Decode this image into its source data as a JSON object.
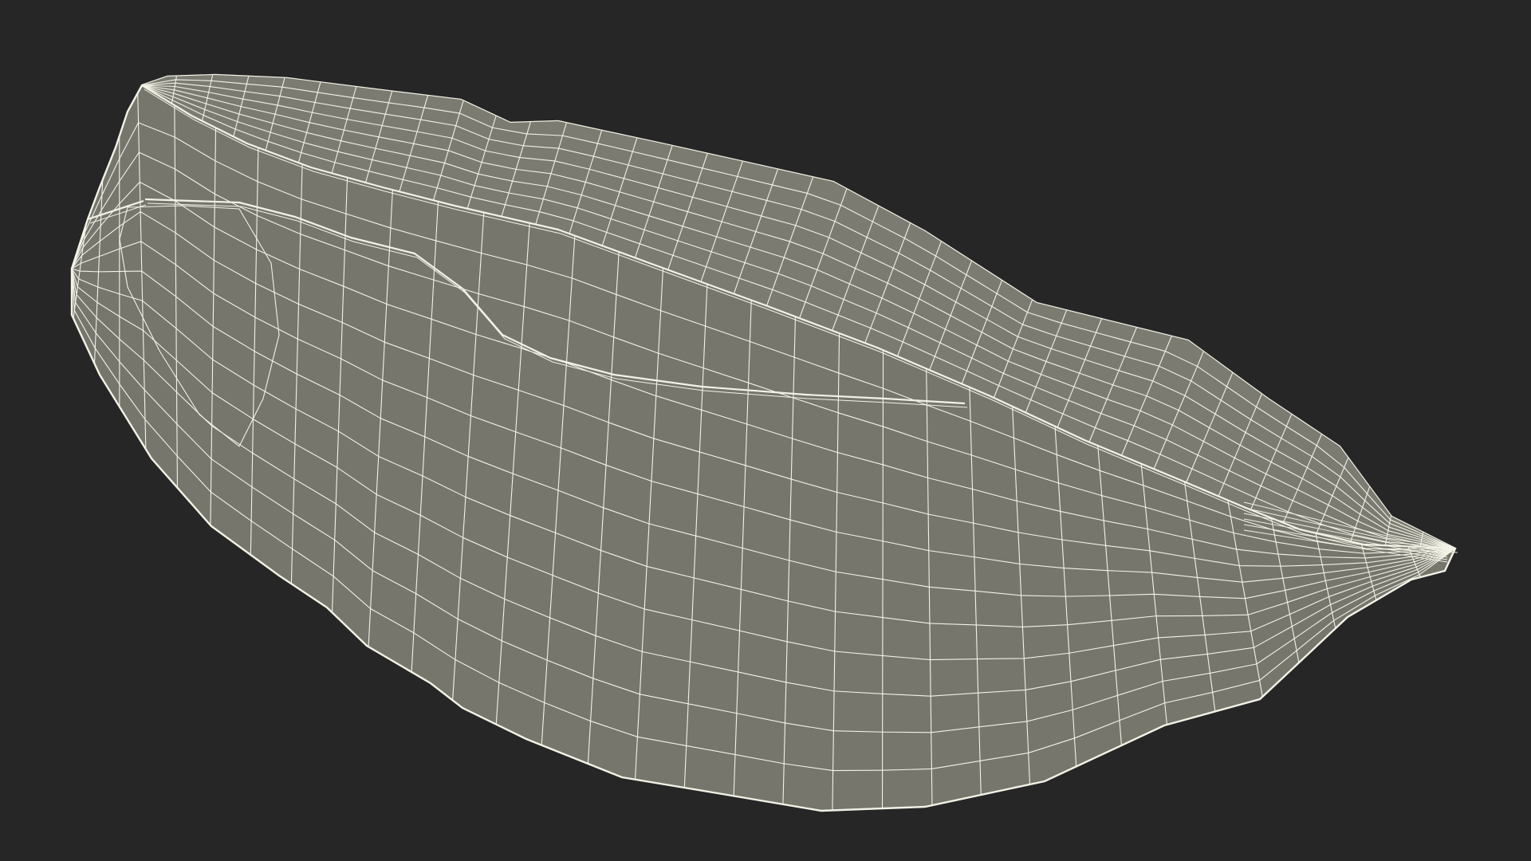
{
  "scene": {
    "background_color": "#262626",
    "mesh_fill_color": "#76766d",
    "top_fill_color": "#7b7b72",
    "wire_color": "#f2f2e6",
    "display_mode": "wireframe-on-shaded",
    "object": "wireframe-leaf-shaped-3d-mesh"
  }
}
